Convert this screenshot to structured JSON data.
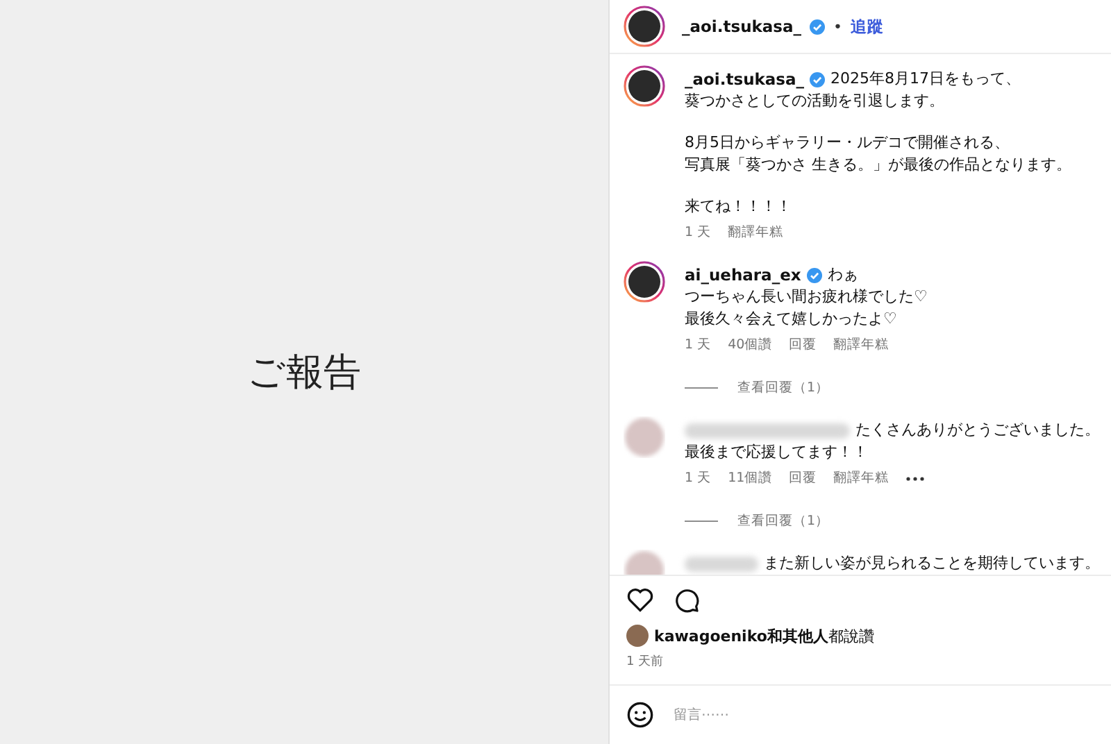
{
  "post_image": {
    "caption": "ご報告"
  },
  "header": {
    "username": "_aoi.tsukasa_",
    "verified": true,
    "separator": "•",
    "follow": "追蹤",
    "story_ring": true
  },
  "comments": [
    {
      "username": "_aoi.tsukasa_",
      "verified": true,
      "story_ring": true,
      "name_hidden": false,
      "paragraphs": [
        [
          "2025年8月17日をもって、",
          "葵つかさとしての活動を引退します。"
        ],
        [
          "8月5日からギャラリー・ルデコで開催される、",
          "写真展「葵つかさ 生きる。」が最後の作品となります。"
        ],
        [
          "来てね！！！！"
        ]
      ],
      "meta": [
        "1 天",
        "翻譯年糕"
      ],
      "more": false
    },
    {
      "username": "ai_uehara_ex",
      "verified": true,
      "story_ring": true,
      "name_hidden": false,
      "paragraphs": [
        [
          "わぁ",
          "つーちゃん長い間お疲れ様でした♡",
          "最後久々会えて嬉しかったよ♡"
        ]
      ],
      "meta": [
        "1 天",
        "40個讚",
        "回覆",
        "翻譯年糕"
      ],
      "more": false,
      "replies": "查看回覆（1）"
    },
    {
      "verified": false,
      "story_ring": false,
      "name_hidden": true,
      "paragraphs": [
        [
          "たくさんありがとうございました。",
          "最後まで応援してます！！"
        ]
      ],
      "meta": [
        "1 天",
        "11個讚",
        "回覆",
        "翻譯年糕"
      ],
      "more": true,
      "replies": "查看回覆（1）"
    },
    {
      "verified": false,
      "story_ring": false,
      "name_hidden": true,
      "paragraphs": [
        [
          "また新しい姿が見られることを期待しています。"
        ]
      ],
      "more": false
    }
  ],
  "actions": {
    "liked": false
  },
  "likes": {
    "user": "kawagoeniko",
    "rest": "和其他人",
    "verb": "都說讚"
  },
  "time_ago": "1 天前",
  "comment_box": {
    "placeholder": "留言⋯⋯"
  }
}
